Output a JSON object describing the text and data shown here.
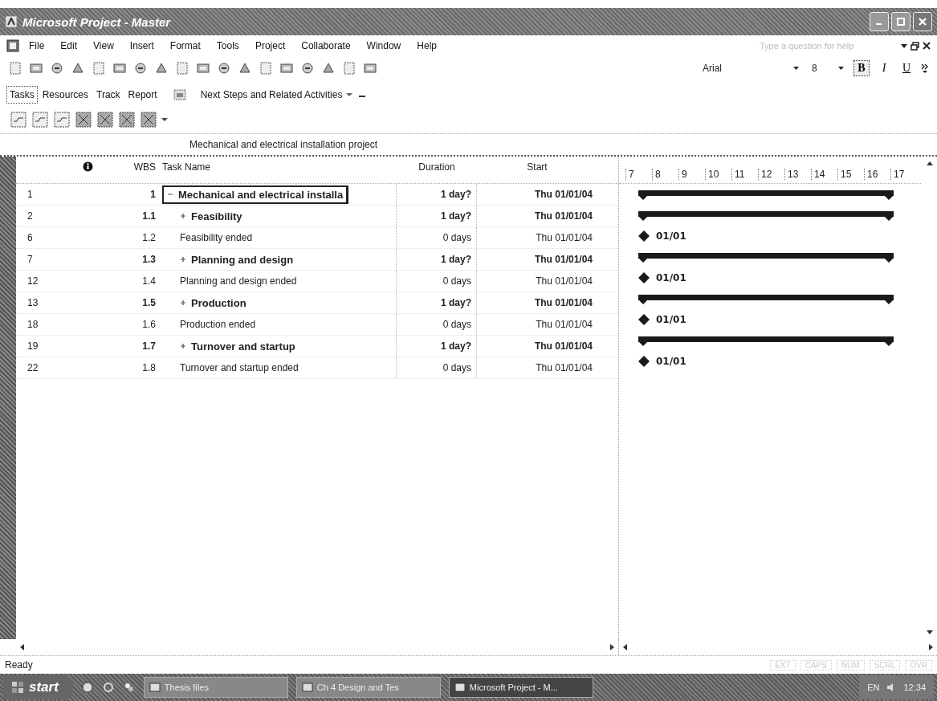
{
  "window": {
    "title": "Microsoft Project - Master"
  },
  "menu": [
    "File",
    "Edit",
    "View",
    "Insert",
    "Format",
    "Tools",
    "Project",
    "Collaborate",
    "Window",
    "Help"
  ],
  "help_box": {
    "placeholder": "Type a question for help"
  },
  "formatting": {
    "font": "Arial",
    "size": "8",
    "buttons": [
      {
        "label": "B",
        "pressed": true
      },
      {
        "label": "I",
        "pressed": false
      },
      {
        "label": "U",
        "pressed": false
      }
    ]
  },
  "view_tabs": [
    {
      "label": "Tasks",
      "selected": true
    },
    {
      "label": "Resources",
      "selected": false
    },
    {
      "label": "Track",
      "selected": false
    },
    {
      "label": "Report",
      "selected": false
    }
  ],
  "next_steps": {
    "label": "Next Steps and Related Activities"
  },
  "project_title": "Mechanical and electrical installation project",
  "table": {
    "columns": [
      "WBS",
      "Task Name",
      "Duration",
      "Start"
    ],
    "rows": [
      {
        "id": "1",
        "wbs": "1",
        "name": "Mechanical and electrical installa",
        "duration": "1 day?",
        "start": "Thu 01/01/04",
        "kind": "summary",
        "expanded": true,
        "selected": true,
        "children": [
          {
            "id": "2",
            "wbs": "1.1",
            "name": "Feasibility",
            "duration": "1 day?",
            "start": "Thu 01/01/04",
            "kind": "summary",
            "expanded": false,
            "selected": false
          },
          {
            "id": "6",
            "wbs": "1.2",
            "name": "Feasibility ended",
            "duration": "0 days",
            "start": "Thu 01/01/04",
            "kind": "milestone",
            "selected": false,
            "bar_label": "01/01"
          },
          {
            "id": "7",
            "wbs": "1.3",
            "name": "Planning and design",
            "duration": "1 day?",
            "start": "Thu 01/01/04",
            "kind": "summary",
            "expanded": false,
            "selected": false
          },
          {
            "id": "12",
            "wbs": "1.4",
            "name": "Planning and design ended",
            "duration": "0 days",
            "start": "Thu 01/01/04",
            "kind": "milestone",
            "selected": false,
            "bar_label": "01/01"
          },
          {
            "id": "13",
            "wbs": "1.5",
            "name": "Production",
            "duration": "1 day?",
            "start": "Thu 01/01/04",
            "kind": "summary",
            "expanded": false,
            "selected": false
          },
          {
            "id": "18",
            "wbs": "1.6",
            "name": "Production ended",
            "duration": "0 days",
            "start": "Thu 01/01/04",
            "kind": "milestone",
            "selected": false,
            "bar_label": "01/01"
          },
          {
            "id": "19",
            "wbs": "1.7",
            "name": "Turnover and startup",
            "duration": "1 day?",
            "start": "Thu 01/01/04",
            "kind": "summary",
            "expanded": false,
            "selected": false
          },
          {
            "id": "22",
            "wbs": "1.8",
            "name": "Turnover and startup ended",
            "duration": "0 days",
            "start": "Thu 01/01/04",
            "kind": "milestone",
            "selected": false,
            "bar_label": "01/01"
          }
        ]
      }
    ]
  },
  "timescale": [
    "7",
    "8",
    "9",
    "10",
    "11",
    "12",
    "13",
    "14",
    "15",
    "16",
    "17"
  ],
  "status_bar": {
    "text": "Ready",
    "indicators": [
      {
        "label": "EXT",
        "on": false
      },
      {
        "label": "CAPS",
        "on": false
      },
      {
        "label": "NUM",
        "on": false
      },
      {
        "label": "SCRL",
        "on": false
      },
      {
        "label": "OVR",
        "on": false
      }
    ]
  },
  "taskbar": {
    "start": "start",
    "buttons": [
      {
        "label": "Thesis files",
        "selected": false
      },
      {
        "label": "Ch 4 Design and Tes",
        "selected": false
      },
      {
        "label": "Microsoft Project - M...",
        "selected": true
      }
    ],
    "language": "EN",
    "clock": "12:34"
  }
}
